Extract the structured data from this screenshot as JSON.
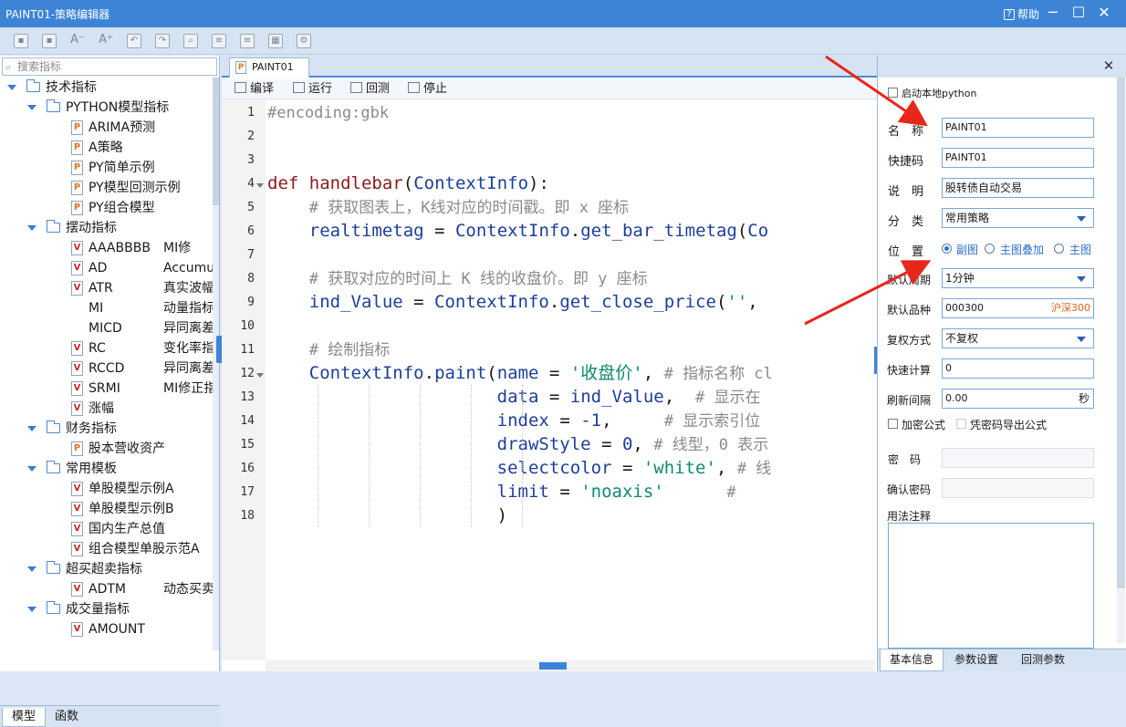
{
  "window": {
    "title": "PAINT01-策略编辑器",
    "help": "帮助",
    "buttons": [
      "minimize",
      "maximize",
      "close"
    ]
  },
  "toolbar": {
    "icons": [
      "save-icon",
      "save-as-icon",
      "font-decrease-icon",
      "font-increase-icon",
      "undo-icon",
      "redo-icon",
      "find-icon",
      "replace-icon",
      "export-icon",
      "import-icon",
      "settings-icon"
    ]
  },
  "sidebar": {
    "search_placeholder": "搜索指标",
    "tree": [
      {
        "label": "技术指标",
        "level": 0
      },
      {
        "label": "PYTHON模型指标",
        "level": 1
      },
      {
        "label": "ARIMA预测",
        "level": 2,
        "icon": "p"
      },
      {
        "label": "A策略",
        "level": 2,
        "icon": "p"
      },
      {
        "label": "PY简单示例",
        "level": 2,
        "icon": "p"
      },
      {
        "label": "PY模型回测示例",
        "level": 2,
        "icon": "p"
      },
      {
        "label": "PY组合模型",
        "level": 2,
        "icon": "p"
      },
      {
        "label": "摆动指标",
        "level": 1
      },
      {
        "label": "AAABBBB",
        "desc": "MI修",
        "level": 2,
        "icon": "v"
      },
      {
        "label": "AD",
        "desc": "Accumulat",
        "level": 2,
        "icon": "v"
      },
      {
        "label": "ATR",
        "desc": "真实波幅",
        "level": 2,
        "icon": "v"
      },
      {
        "label": "MI",
        "desc": "动量指标",
        "level": 2,
        "icon": ""
      },
      {
        "label": "MICD",
        "desc": "异同离差动",
        "level": 2,
        "icon": ""
      },
      {
        "label": "RC",
        "desc": "变化率指数",
        "level": 2,
        "icon": "v"
      },
      {
        "label": "RCCD",
        "desc": "异同离差",
        "level": 2,
        "icon": "v"
      },
      {
        "label": "SRMI",
        "desc": "MI修正指",
        "level": 2,
        "icon": "v"
      },
      {
        "label": "涨幅",
        "level": 2,
        "icon": "v"
      },
      {
        "label": "财务指标",
        "level": 1
      },
      {
        "label": "股本营收资产",
        "level": 2,
        "icon": "p"
      },
      {
        "label": "常用模板",
        "level": 1
      },
      {
        "label": "单股模型示例A",
        "level": 2,
        "icon": "v"
      },
      {
        "label": "单股模型示例B",
        "level": 2,
        "icon": "v"
      },
      {
        "label": "国内生产总值",
        "level": 2,
        "icon": "v"
      },
      {
        "label": "组合模型单股示范A",
        "level": 2,
        "icon": "v"
      },
      {
        "label": "超买超卖指标",
        "level": 1
      },
      {
        "label": "ADTM",
        "desc": "动态买卖",
        "level": 2,
        "icon": "v"
      },
      {
        "label": "成交量指标",
        "level": 1
      },
      {
        "label": "AMOUNT",
        "level": 2,
        "icon": "v"
      }
    ],
    "tabs": [
      "模型",
      "函数"
    ]
  },
  "editor": {
    "file_tab": "PAINT01",
    "tools": [
      "编译",
      "运行",
      "回测",
      "停止"
    ],
    "lines": [
      {
        "n": "1",
        "html": "<span class='cm'>#encoding:gbk</span>"
      },
      {
        "n": "2",
        "html": ""
      },
      {
        "n": "3",
        "html": ""
      },
      {
        "n": "4",
        "html": "<span class='k'>def</span> <span class='f'>handlebar</span>(<span class='n'>ContextInfo</span>):"
      },
      {
        "n": "5",
        "html": "    <span class='cm'># 获取图表上，K线对应的时间戳。即 x 座标</span>"
      },
      {
        "n": "6",
        "html": "    <span class='n'>realtimetag</span> = <span class='n'>ContextInfo</span>.<span class='n'>get_bar_timetag</span>(<span class='n'>Co</span>"
      },
      {
        "n": "7",
        "html": ""
      },
      {
        "n": "8",
        "html": "    <span class='cm'># 获取对应的时间上 K 线的收盘价。即 y 座标</span>"
      },
      {
        "n": "9",
        "html": "    <span class='n'>ind_Value</span> = <span class='n'>ContextInfo</span>.<span class='n'>get_close_price</span>(<span class='s'>''</span>, "
      },
      {
        "n": "10",
        "html": ""
      },
      {
        "n": "11",
        "html": "    <span class='cm'># 绘制指标</span>"
      },
      {
        "n": "12",
        "html": "    <span class='n'>ContextInfo</span>.<span class='n'>paint</span>(<span class='n'>name</span> = <span class='s'>'收盘价'</span>, <span class='cm'># 指标名称 cl</span>"
      },
      {
        "n": "13",
        "html": "                      <span class='n'>data</span> = <span class='n'>ind_Value</span>,  <span class='cm'># 显示在</span>"
      },
      {
        "n": "14",
        "html": "                      <span class='n'>index</span> = <span class='n'>-1</span>,     <span class='cm'># 显示索引位</span>"
      },
      {
        "n": "15",
        "html": "                      <span class='n'>drawStyle</span> = <span class='n'>0</span>, <span class='cm'># 线型，0 表示</span>"
      },
      {
        "n": "16",
        "html": "                      <span class='n'>selectcolor</span> = <span class='s'>'white'</span>, <span class='cm'># 线</span>"
      },
      {
        "n": "17",
        "html": "                      <span class='n'>limit</span> = <span class='s'>'noaxis'</span>      <span class='cm'>#</span>"
      },
      {
        "n": "18",
        "html": "                      )"
      }
    ]
  },
  "props": {
    "enable_python": "启动本地python",
    "name_label": "名　称",
    "name_value": "PAINT01",
    "shortcut_label": "快捷码",
    "shortcut_value": "PAINT01",
    "desc_label": "说　明",
    "desc_value": "股转债自动交易",
    "category_label": "分　类",
    "category_value": "常用策略",
    "position_label": "位　置",
    "position_options": [
      "副图",
      "主图叠加",
      "主图"
    ],
    "position_selected": "副图",
    "period_label": "默认周期",
    "period_value": "1分钟",
    "stock_label": "默认品种",
    "stock_value": "000300",
    "stock_name": "沪深300",
    "rights_label": "复权方式",
    "rights_value": "不复权",
    "fastcalc_label": "快速计算",
    "fastcalc_value": "0",
    "refresh_label": "刷新间隔",
    "refresh_value": "0.00",
    "refresh_unit": "秒",
    "encrypt_label": "加密公式",
    "export_pwd_label": "凭密码导出公式",
    "password_label": "密　码",
    "confirm_label": "确认密码",
    "usage_label": "用法注释",
    "tabs": [
      "基本信息",
      "参数设置",
      "回测参数"
    ]
  }
}
